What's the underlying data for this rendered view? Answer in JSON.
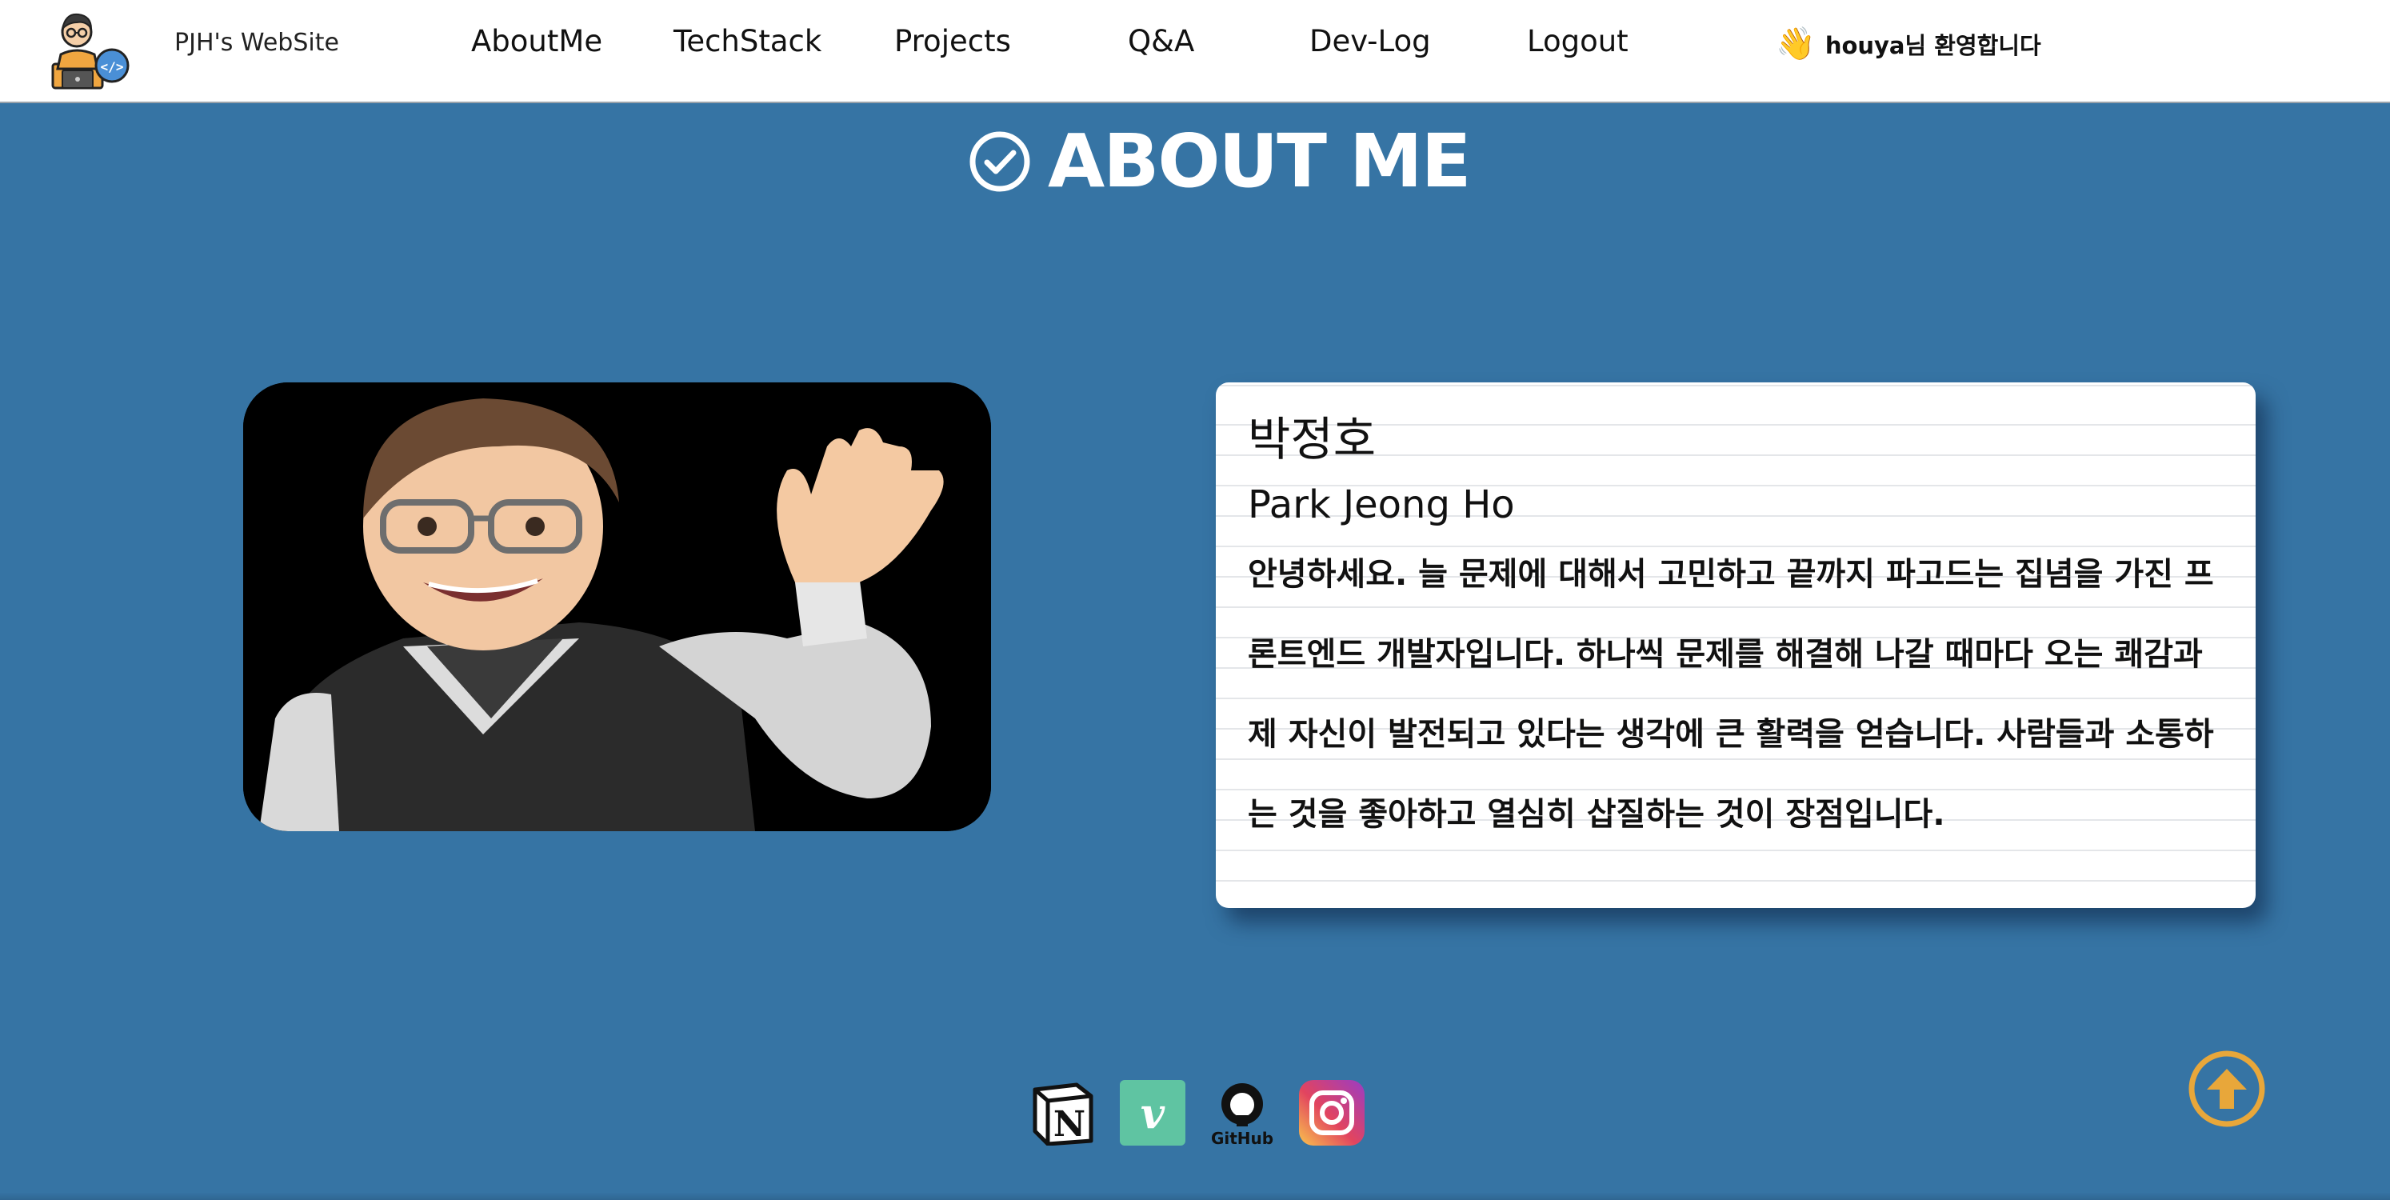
{
  "header": {
    "site_title": "PJH's WebSite",
    "nav": [
      "AboutMe",
      "TechStack",
      "Projects",
      "Q&A",
      "Dev-Log",
      "Logout"
    ],
    "welcome": "houya님 환영합니다",
    "welcome_icon": "waving-hand-icon"
  },
  "section": {
    "title": "ABOUT ME",
    "icon": "check-circle-icon"
  },
  "profile": {
    "name_ko": "박정호",
    "name_en": "Park Jeong Ho",
    "intro": "안녕하세요. 늘 문제에 대해서 고민하고 끝까지 파고드는 집념을 가진 프론트엔드 개발자입니다. 하나씩 문제를 해결해 나갈 때마다 오는 쾌감과 제 자신이 발전되고 있다는 생각에 큰 활력을 얻습니다. 사람들과 소통하는 것을 좋아하고 열심히 삽질하는 것이 장점입니다."
  },
  "socials": {
    "notion": "N",
    "velog": "v",
    "github": "GitHub",
    "instagram_icon": "instagram-icon"
  },
  "colors": {
    "background": "#3674a4",
    "accent": "#e8a73a",
    "velog": "#5fc4a2"
  }
}
